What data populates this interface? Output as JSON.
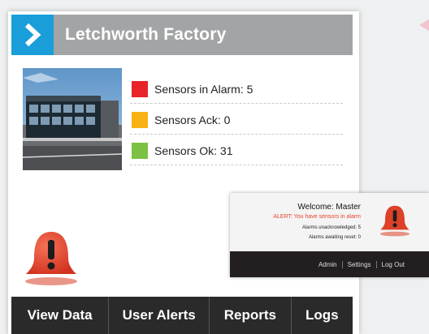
{
  "header": {
    "title": "Letchworth Factory"
  },
  "statuses": [
    {
      "label": "Sensors in Alarm: 5",
      "color": "#e8232a"
    },
    {
      "label": "Sensors Ack: 0",
      "color": "#f9b214"
    },
    {
      "label": "Sensors Ok: 31",
      "color": "#7cc143"
    }
  ],
  "nav": {
    "view_data": "View Data",
    "user_alerts": "User Alerts",
    "reports": "Reports",
    "logs": "Logs"
  },
  "popup": {
    "welcome": "Welcome: Master",
    "alert": "ALERT: You have sensors in alarm",
    "unacknowledged": "Alarms unacknowledged: 5",
    "awaiting_reset": "Alarms awaiting reset: 0",
    "links": {
      "admin": "Admin",
      "settings": "Settings",
      "logout": "Log Out"
    }
  },
  "colors": {
    "accent": "#1a9ed9",
    "header_bg": "#a3a4a5",
    "alarm_red": "#e8402a"
  },
  "icons": {
    "header": "chevron-right-icon",
    "alarm": "alarm-bell-icon"
  }
}
